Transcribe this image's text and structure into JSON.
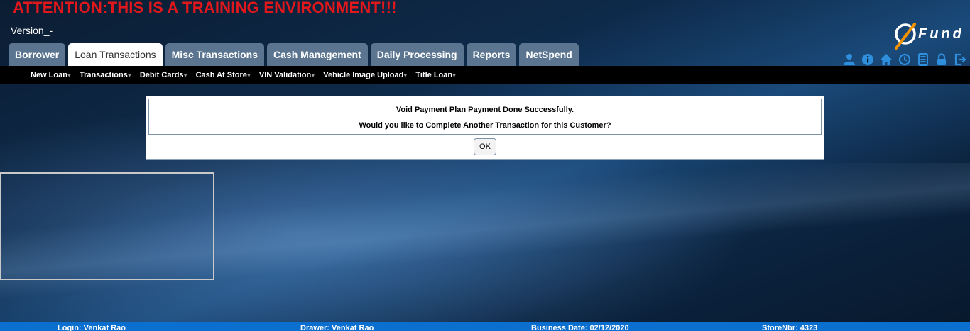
{
  "banner": {
    "attention": "ATTENTION:THIS IS A TRAINING ENVIRONMENT!!!",
    "version": "Version_-"
  },
  "logo": {
    "text": "Fund",
    "accent_color": "#f39200"
  },
  "tabs": [
    {
      "label": "Borrower",
      "active": false
    },
    {
      "label": "Loan Transactions",
      "active": true
    },
    {
      "label": "Misc Transactions",
      "active": false
    },
    {
      "label": "Cash Management",
      "active": false
    },
    {
      "label": "Daily Processing",
      "active": false
    },
    {
      "label": "Reports",
      "active": false
    },
    {
      "label": "NetSpend",
      "active": false
    }
  ],
  "toolbar_icons": [
    "user-icon",
    "info-icon",
    "home-icon",
    "clock-icon",
    "calculator-icon",
    "lock-icon",
    "logout-icon"
  ],
  "submenu": [
    "New Loan",
    "Transactions",
    "Debit Cards",
    "Cash At Store",
    "VIN Validation",
    "Vehicle Image Upload",
    "Title Loan"
  ],
  "dialog": {
    "message1": "Void Payment Plan Payment Done Successfully.",
    "message2": "Would you like to Complete Another Transaction for this Customer?",
    "ok_label": "OK"
  },
  "footer": {
    "login": "Login: Venkat Rao",
    "drawer": "Drawer: Venkat Rao",
    "business_date": "Business Date: 02/12/2020",
    "store": "StoreNbr: 4323"
  },
  "colors": {
    "attention": "#e0171b",
    "tab_bg": "#5b7590",
    "footer_bg": "#0a6fcf",
    "icon": "#2f8fdc"
  }
}
